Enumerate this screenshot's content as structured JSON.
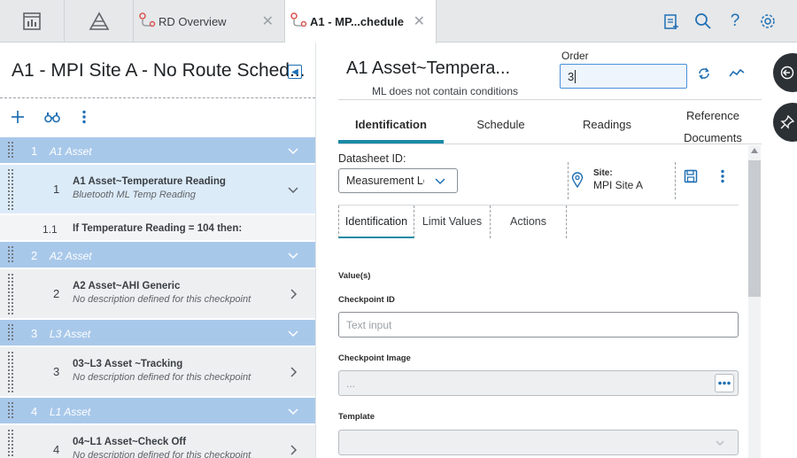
{
  "topbar": {
    "tabs": [
      {
        "label": "RD Overview",
        "close": "✕"
      },
      {
        "label": "A1 - MP...chedule",
        "close": "✕"
      }
    ]
  },
  "left": {
    "title": "A1 - MPI Site A - No Route Sched...",
    "rows": [
      {
        "kind": "group",
        "num": "1",
        "label": "A1 Asset"
      },
      {
        "kind": "item",
        "num": "1",
        "title": "A1 Asset~Temperature Reading",
        "sub": "Bluetooth ML Temp Reading",
        "selected": true
      },
      {
        "kind": "cond",
        "num": "1.1",
        "title": "If Temperature Reading = 104 then:"
      },
      {
        "kind": "group",
        "num": "2",
        "label": "A2 Asset"
      },
      {
        "kind": "item",
        "num": "2",
        "title": "A2 Asset~AHI Generic",
        "sub": "No description defined for this checkpoint"
      },
      {
        "kind": "group",
        "num": "3",
        "label": "L3 Asset"
      },
      {
        "kind": "item",
        "num": "3",
        "title": "03~L3 Asset ~Tracking",
        "sub": "No description defined for this checkpoint"
      },
      {
        "kind": "group",
        "num": "4",
        "label": "L1 Asset"
      },
      {
        "kind": "item",
        "num": "4",
        "title": "04~L1 Asset~Check Off",
        "sub": "No description defined for this checkpoint"
      }
    ]
  },
  "right": {
    "title": "A1 Asset~Tempera...",
    "subtitle": "ML does not contain conditions",
    "order_label": "Order",
    "order_value": "3",
    "tabs": [
      "Identification",
      "Schedule",
      "Readings",
      "Reference Documents"
    ],
    "datasheet_label": "Datasheet ID:",
    "datasheet_value": "Measurement Lo",
    "site_label": "Site:",
    "site_value": "MPI Site A",
    "subtabs": [
      "Identification",
      "Limit Values",
      "Actions"
    ],
    "values_label": "Value(s)",
    "checkpoint_id_label": "Checkpoint ID",
    "checkpoint_id_placeholder": "Text input",
    "checkpoint_image_label": "Checkpoint Image",
    "checkpoint_image_value": "...",
    "template_label": "Template"
  },
  "colors": {
    "accent": "#1a8aa6",
    "group_row": "#a8c8ea",
    "link_blue": "#1f6fb3",
    "selected_row": "#dcebf8"
  }
}
